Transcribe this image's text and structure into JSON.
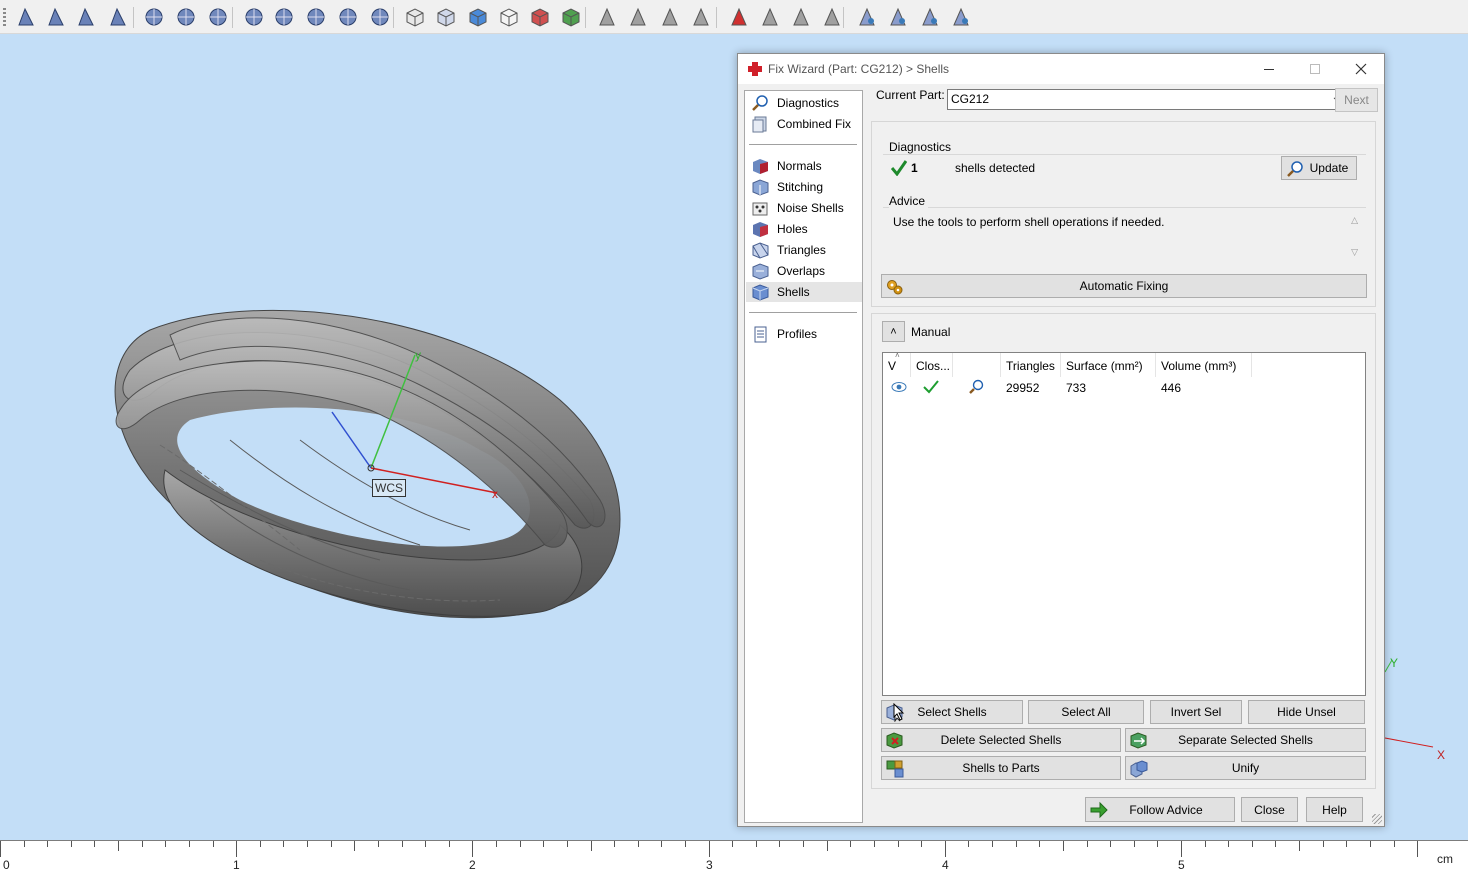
{
  "toolbar": {
    "icons": [
      "select-triangle-icon",
      "select-surface-icon",
      "select-shell-icon",
      "select-part-icon",
      "select-window-icon",
      "select-connected-icon",
      "select-curve-icon",
      "select-plane-icon",
      "select-grow-icon",
      "select-lasso-icon",
      "select-ring-icon",
      "select-brush-icon",
      "cube-icon",
      "cube-shaded-icon",
      "cube-color-icon",
      "cube-wire-icon",
      "cube-section-icon",
      "cube-green-icon",
      "triangle-normal-icon",
      "triangle-edge-icon",
      "triangle-point-icon",
      "triangle-blue-icon",
      "triangle-delete-icon",
      "triangle-grey-icon",
      "triangle-grey2-icon",
      "triangle-grey3-icon",
      "measure-icon",
      "measure-blue-icon",
      "measure-blue2-icon",
      "measure-grey-icon"
    ]
  },
  "viewport": {
    "wcs_label": "WCS",
    "axis_y": "y",
    "axis_x": "x",
    "corner_axis_y": "Y",
    "corner_axis_x": "X"
  },
  "ruler": {
    "labels": [
      "0",
      "1",
      "2",
      "3",
      "4",
      "5"
    ],
    "unit": "cm"
  },
  "dialog": {
    "title": "Fix Wizard (Part: CG212) > Shells",
    "nav": {
      "group1": [
        "Diagnostics",
        "Combined Fix"
      ],
      "group2": [
        "Normals",
        "Stitching",
        "Noise Shells",
        "Holes",
        "Triangles",
        "Overlaps",
        "Shells"
      ],
      "group3": [
        "Profiles"
      ],
      "selected": "Shells"
    },
    "current_part_label": "Current Part:",
    "current_part_value": "CG212",
    "next_label": "Next",
    "diagnostics": {
      "title": "Diagnostics",
      "count": "1",
      "text": "shells detected",
      "update_label": "Update"
    },
    "advice": {
      "title": "Advice",
      "text": "Use the tools to perform shell operations if needed."
    },
    "automatic_fixing_label": "Automatic Fixing",
    "manual": {
      "title": "Manual",
      "columns": [
        "V",
        "Clos...",
        "",
        "Triangles",
        "Surface (mm²)",
        "Volume (mm³)"
      ],
      "rows": [
        {
          "triangles": "29952",
          "surface": "733",
          "volume": "446"
        }
      ]
    },
    "buttons": {
      "select_shells": "Select Shells",
      "select_all": "Select All",
      "invert_sel": "Invert Sel",
      "hide_unsel": "Hide Unsel",
      "delete_selected": "Delete Selected Shells",
      "separate_selected": "Separate Selected Shells",
      "shells_to_parts": "Shells to Parts",
      "unify": "Unify",
      "follow_advice": "Follow Advice",
      "close": "Close",
      "help": "Help"
    }
  },
  "colors": {
    "viewport_bg": "#c3def7",
    "accent_red": "#d0202a",
    "check_green": "#1e9e30"
  }
}
